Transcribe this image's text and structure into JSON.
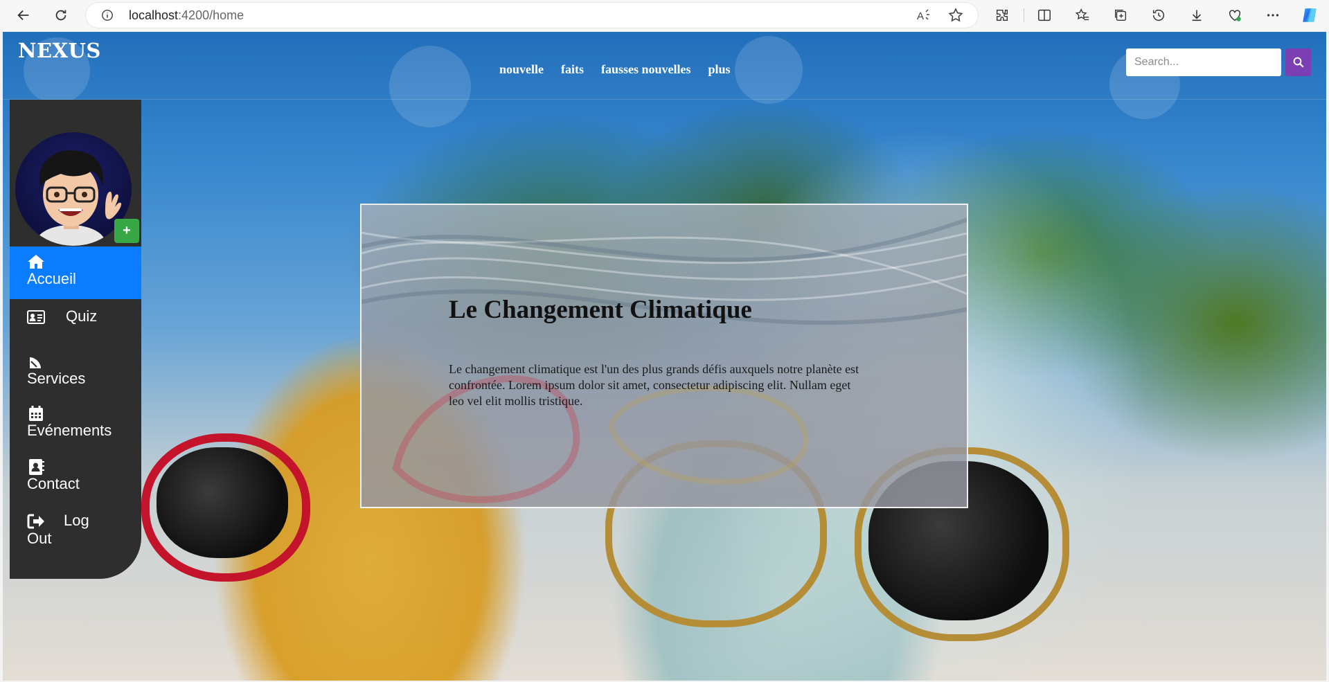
{
  "browser": {
    "url_host": "localhost",
    "url_rest": ":4200/home",
    "icons": [
      "back-icon",
      "refresh-icon",
      "info-icon",
      "read-aloud-icon",
      "favorite-star-icon",
      "extensions-icon",
      "split-screen-icon",
      "favorites-icon",
      "collections-icon",
      "history-icon",
      "downloads-icon",
      "browser-essentials-icon",
      "more-icon",
      "copilot-icon"
    ]
  },
  "navbar": {
    "brand": "NEXUS",
    "links": [
      "nouvelle",
      "faits",
      "fausses nouvelles",
      "plus"
    ],
    "search_placeholder": "Search..."
  },
  "sidebar": {
    "add_label": "+",
    "items": [
      {
        "label": "Accueil",
        "icon": "home-icon",
        "active": true
      },
      {
        "label": "Quiz",
        "icon": "id-card-icon"
      },
      {
        "label": "Services",
        "icon": "satellite-dish-icon"
      },
      {
        "label": "Evénements",
        "icon": "calendar-icon"
      },
      {
        "label": "Contact",
        "icon": "address-book-icon"
      },
      {
        "label": "Log Out",
        "icon": "sign-out-icon"
      }
    ]
  },
  "card": {
    "title": "Le Changement Climatique",
    "text": "Le changement climatique est l'un des plus grands défis auxquels notre planète est confrontée. Lorem ipsum dolor sit amet, consectetur adipiscing elit. Nullam eget leo vel elit mollis tristique."
  },
  "colors": {
    "active_menu": "#0a7cff",
    "sidebar_bg": "#2e2e2e",
    "search_button": "#7b3fb3",
    "add_button": "#38a846"
  }
}
